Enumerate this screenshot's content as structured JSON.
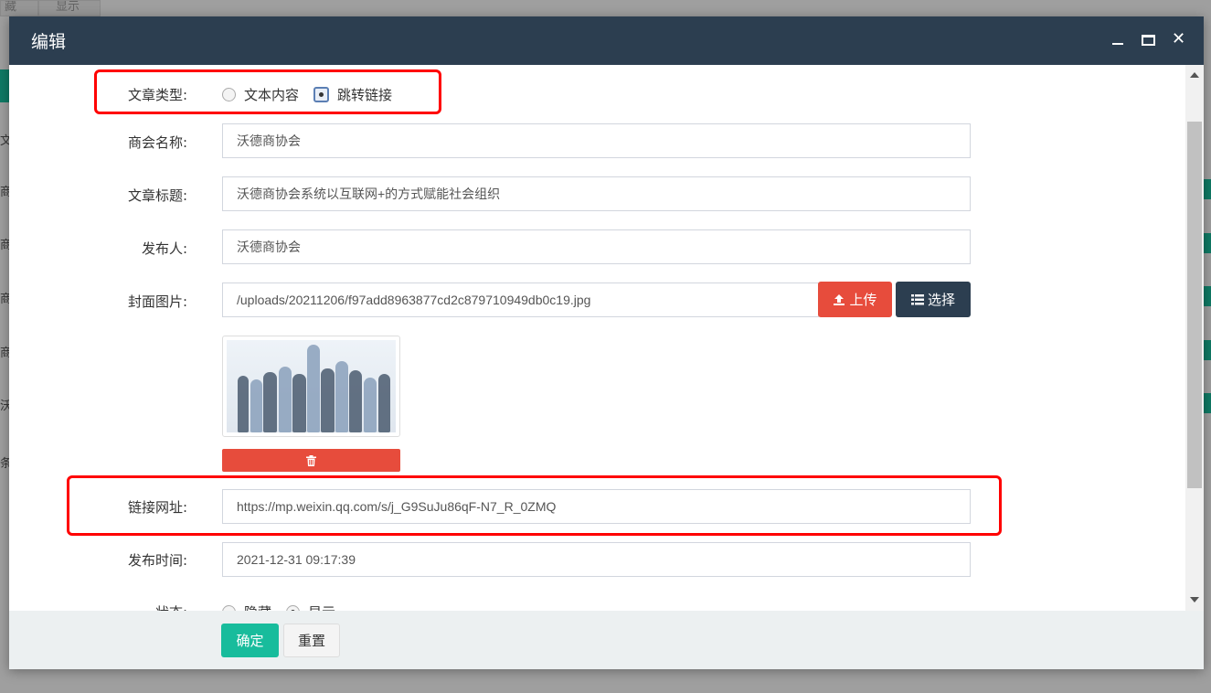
{
  "background": {
    "tabs": [
      "藏",
      "显示"
    ],
    "rows": [
      "文章",
      "商会",
      "商会",
      "商会",
      "商会",
      "沃德",
      "条"
    ]
  },
  "modal": {
    "title": "编辑",
    "window_controls": {
      "minimize_icon": "minimize-icon",
      "maximize_icon": "maximize-icon",
      "close_icon": "close-icon",
      "close_glyph": "✕"
    }
  },
  "form": {
    "article_type": {
      "label": "文章类型:",
      "options": [
        "文本内容",
        "跳转链接"
      ],
      "selected": "跳转链接"
    },
    "chamber_name": {
      "label": "商会名称:",
      "value": "沃德商协会"
    },
    "article_title": {
      "label": "文章标题:",
      "value": "沃德商协会系统以互联网+的方式赋能社会组织"
    },
    "publisher": {
      "label": "发布人:",
      "value": "沃德商协会"
    },
    "cover_image": {
      "label": "封面图片:",
      "value": "/uploads/20211206/f97add8963877cd2c879710949db0c19.jpg",
      "upload_label": "上传",
      "choose_label": "选择",
      "upload_icon": "upload-icon",
      "list_icon": "list-icon",
      "delete_icon": "trash-icon"
    },
    "link_url": {
      "label": "链接网址:",
      "value": "https://mp.weixin.qq.com/s/j_G9SuJu86qF-N7_R_0ZMQ"
    },
    "publish_time": {
      "label": "发布时间:",
      "value": "2021-12-31 09:17:39"
    },
    "status": {
      "label": "状态:",
      "options": [
        "隐藏",
        "显示"
      ],
      "selected": "显示"
    }
  },
  "footer": {
    "ok_label": "确定",
    "reset_label": "重置"
  },
  "colors": {
    "header_bg": "#2c3e50",
    "primary_green": "#18bc9c",
    "danger_red": "#e74c3c",
    "highlight_red": "#ff0000"
  }
}
